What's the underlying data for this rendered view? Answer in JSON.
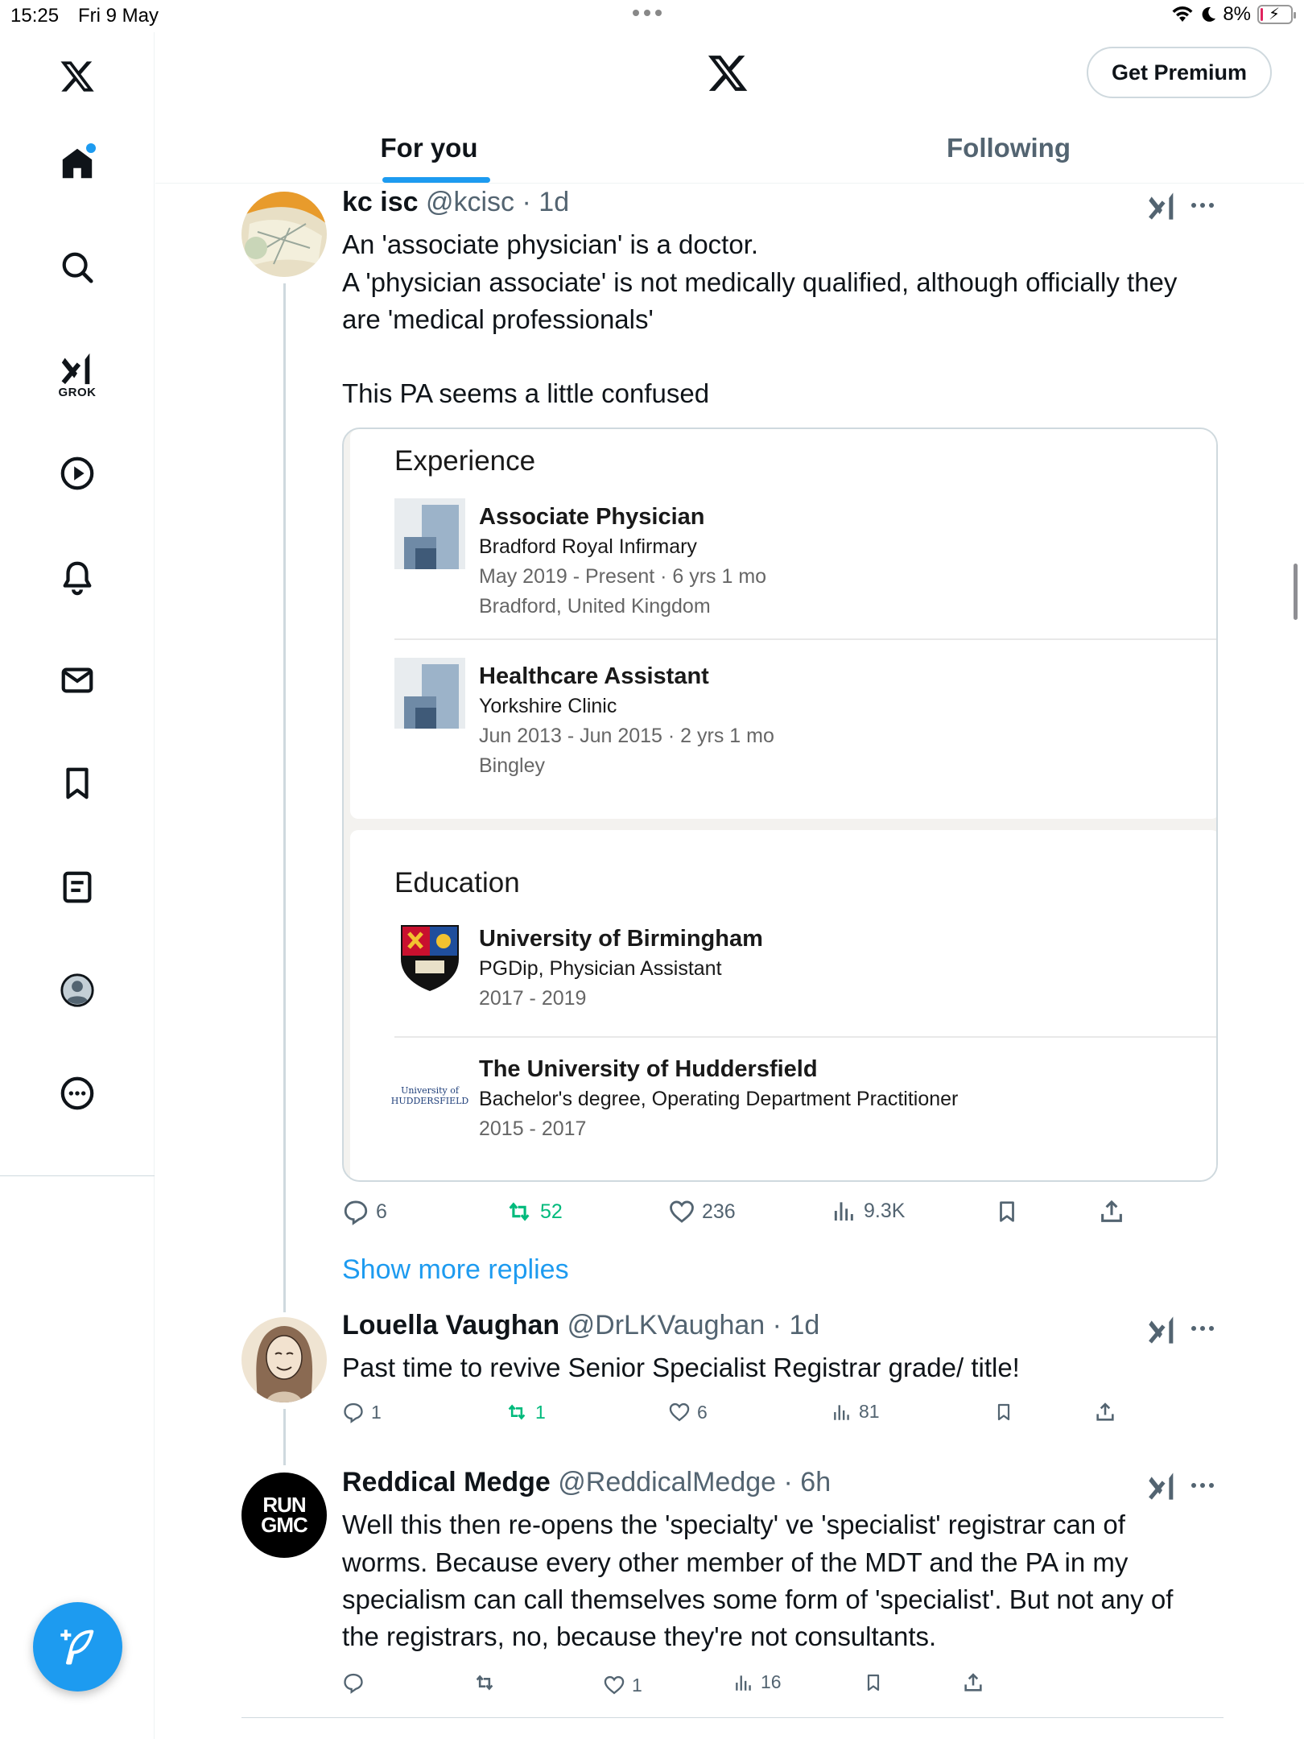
{
  "status_bar": {
    "time": "15:25",
    "date": "Fri 9 May",
    "battery": "8%",
    "battery_level": 0.08
  },
  "header": {
    "premium_label": "Get Premium",
    "tabs": [
      {
        "label": "For you",
        "active": true
      },
      {
        "label": "Following",
        "active": false
      }
    ]
  },
  "sidebar": {
    "items": [
      {
        "icon": "x-logo-icon"
      },
      {
        "icon": "home-icon",
        "notification_dot": true
      },
      {
        "icon": "search-icon"
      },
      {
        "icon": "grok-icon",
        "label": "GROK"
      },
      {
        "icon": "video-play-icon"
      },
      {
        "icon": "bell-icon"
      },
      {
        "icon": "mail-icon"
      },
      {
        "icon": "bookmark-icon"
      },
      {
        "icon": "lists-icon"
      },
      {
        "icon": "profile-icon"
      },
      {
        "icon": "more-icon"
      }
    ],
    "compose_icon": "compose-icon"
  },
  "tweets": [
    {
      "name": "kc isc",
      "handle": "@kcisc",
      "time": "· 1d",
      "lines": [
        "An 'associate physician' is a doctor.",
        "A 'physician associate' is not medically qualified, although officially they",
        "are 'medical professionals'",
        "This PA seems a little confused"
      ],
      "media": {
        "experience_title": "Experience",
        "experience": [
          {
            "title": "Associate Physician",
            "org": "Bradford Royal Infirmary",
            "dates": "May 2019 - Present · 6 yrs 1 mo",
            "place": "Bradford, United Kingdom"
          },
          {
            "title": "Healthcare Assistant",
            "org": "Yorkshire Clinic",
            "dates": "Jun 2013 - Jun 2015 · 2 yrs 1 mo",
            "place": "Bingley"
          }
        ],
        "education_title": "Education",
        "education": [
          {
            "title": "University of Birmingham",
            "degree": "PGDip, Physician Assistant",
            "dates": "2017 - 2019"
          },
          {
            "title": "The University of Huddersfield",
            "degree": "Bachelor's degree, Operating Department Practitioner",
            "dates": "2015 - 2017",
            "logo_text": "University of HUDDERSFIELD"
          }
        ]
      },
      "stats": {
        "replies": "6",
        "reposts": "52",
        "likes": "236",
        "views": "9.3K"
      }
    },
    {
      "name": "Louella Vaughan",
      "handle": "@DrLKVaughan",
      "time": "· 1d",
      "text": "Past time to revive Senior Specialist Registrar grade/ title!",
      "stats": {
        "replies": "1",
        "reposts": "1",
        "likes": "6",
        "views": "81"
      }
    },
    {
      "name": "Reddical Medge",
      "handle": "@ReddicalMedge",
      "time": "· 6h",
      "avatar_text": "RUN GMC",
      "lines": [
        "Well this then re-opens the 'specialty' ve 'specialist' registrar can of",
        "worms. Because every other member of the MDT and the PA in my",
        "specialism can call themselves some form of 'specialist'. But not any of",
        "the registrars, no, because they're not consultants."
      ],
      "stats": {
        "likes": "1",
        "views": "16"
      }
    }
  ],
  "show_more_replies": "Show more replies",
  "colors": {
    "accent": "#1d9bf0",
    "repost": "#00ba7c",
    "muted": "#536471"
  }
}
